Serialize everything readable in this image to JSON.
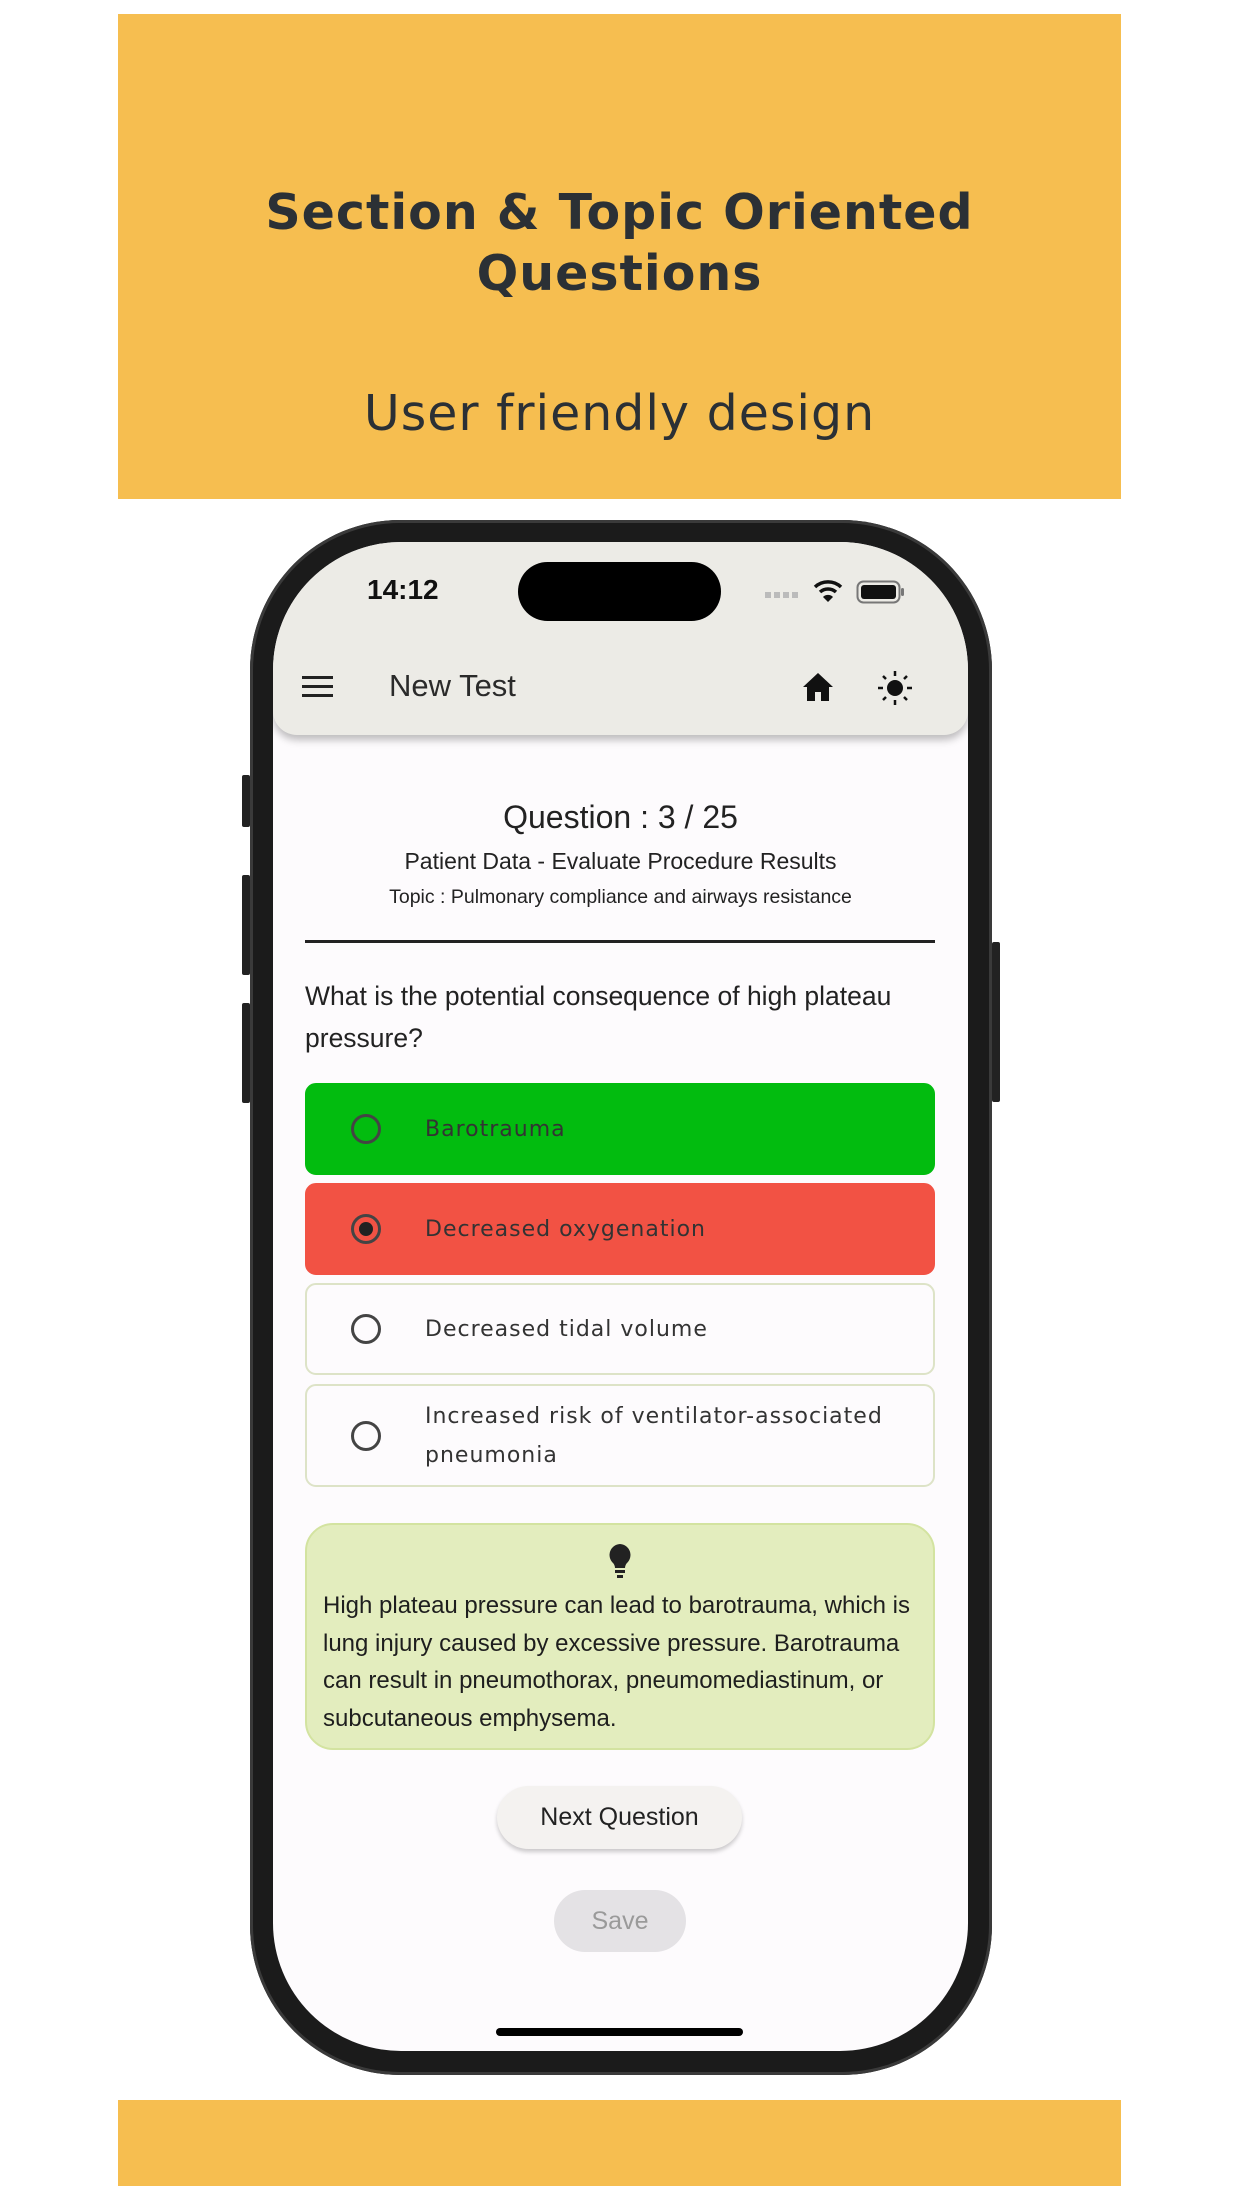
{
  "banner": {
    "title_line1": "Section & Topic Oriented",
    "title_line2": "Questions",
    "subtitle": "User friendly design",
    "color": "#F6BE50"
  },
  "status_bar": {
    "time": "14:12"
  },
  "app_bar": {
    "title": "New Test",
    "icons": [
      "menu-icon",
      "home-icon",
      "brightness-icon"
    ]
  },
  "question": {
    "counter": "Question : 3 / 25",
    "section": "Patient Data - Evaluate Procedure Results",
    "topic": "Topic : Pulmonary compliance and airways resistance",
    "text": "What is the potential consequence of high plateau pressure?"
  },
  "options": [
    {
      "label": "Barotrauma",
      "state": "correct",
      "color": "#02BC0F",
      "selected": false
    },
    {
      "label": "Decreased oxygenation",
      "state": "wrong",
      "color": "#F25244",
      "selected": true
    },
    {
      "label": "Decreased tidal volume",
      "state": "neutral",
      "selected": false
    },
    {
      "label": "Increased risk of ventilator-associated pneumonia",
      "state": "neutral",
      "selected": false
    }
  ],
  "hint": {
    "icon": "lightbulb-icon",
    "text": "High plateau pressure can lead to barotrauma, which is lung injury caused by excessive pressure. Barotrauma can result in pneumothorax, pneumomediastinum, or subcutaneous emphysema."
  },
  "buttons": {
    "next": "Next Question",
    "save": "Save"
  }
}
